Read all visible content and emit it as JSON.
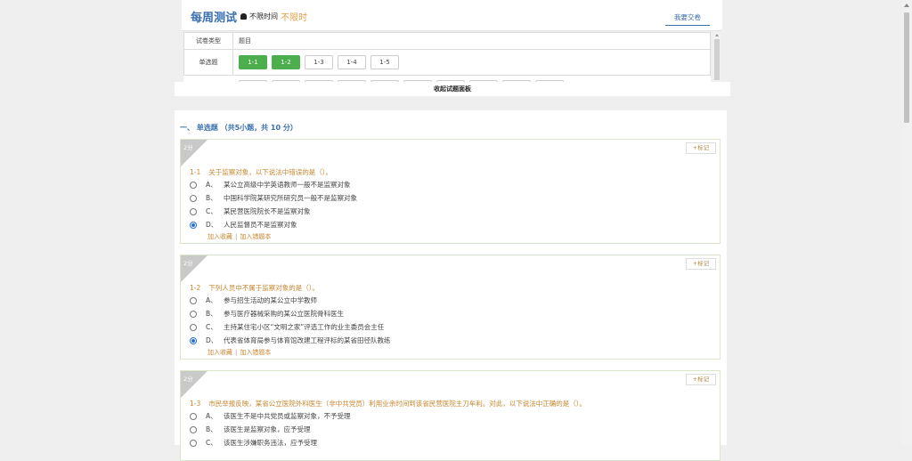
{
  "header": {
    "title": "每周测试",
    "timer_label": "不限时间",
    "timer_value": "不限时",
    "submit_label": "我要交卷"
  },
  "panel": {
    "col_type": "试卷类型",
    "col_questions": "题目",
    "row_type": "单选题",
    "buttons": [
      {
        "label": "1-1",
        "answered": true
      },
      {
        "label": "1-2",
        "answered": true
      },
      {
        "label": "1-3",
        "answered": false
      },
      {
        "label": "1-4",
        "answered": false
      },
      {
        "label": "1-5",
        "answered": false
      }
    ],
    "collapse_label": "收起试题面板"
  },
  "section": {
    "title": "一、 单选题 （共5小题，共 10 分）"
  },
  "questions": [
    {
      "score": "2分",
      "mark_label": "+标记",
      "number": "1-1",
      "stem": "关于监察对象，以下说法中错误的是（）。",
      "options": [
        {
          "letter": "A、",
          "text": "某公立高级中学英语教师一般不是监察对象",
          "checked": false
        },
        {
          "letter": "B、",
          "text": "中国科学院某研究所研究员一般不是监察对象",
          "checked": false
        },
        {
          "letter": "C、",
          "text": "某民营医院院长不是监察对象",
          "checked": false
        },
        {
          "letter": "D、",
          "text": "人民监督员不是监察对象",
          "checked": true
        }
      ],
      "fav_label": "加入收藏",
      "wrong_label": "加入错题本"
    },
    {
      "score": "2分",
      "mark_label": "+标记",
      "number": "1-2",
      "stem": "下列人员中不属于监察对象的是（）。",
      "options": [
        {
          "letter": "A、",
          "text": "参与招生活动的某公立中学教师",
          "checked": false
        },
        {
          "letter": "B、",
          "text": "参与医疗器械采购的某公立医院骨科医生",
          "checked": false
        },
        {
          "letter": "C、",
          "text": "主持某住宅小区“文明之家”评选工作的业主委员会主任",
          "checked": false
        },
        {
          "letter": "D、",
          "text": "代表省体育局参与体育馆改建工程评标的某省田径队教练",
          "checked": true
        }
      ],
      "fav_label": "加入收藏",
      "wrong_label": "加入错题本"
    },
    {
      "score": "2分",
      "mark_label": "+标记",
      "number": "1-3",
      "stem": "市民举报反映，某省公立医院外科医生（非中共党员）利用业余时间到该省民营医院主刀牟利。对此，以下说法中正确的是（）。",
      "options": [
        {
          "letter": "A、",
          "text": "该医生不是中共党员或监察对象，不予受理",
          "checked": false
        },
        {
          "letter": "B、",
          "text": "该医生是监察对象，应予受理",
          "checked": false
        },
        {
          "letter": "C、",
          "text": "该医生涉嫌职务违法，应予受理",
          "checked": false
        }
      ]
    }
  ]
}
